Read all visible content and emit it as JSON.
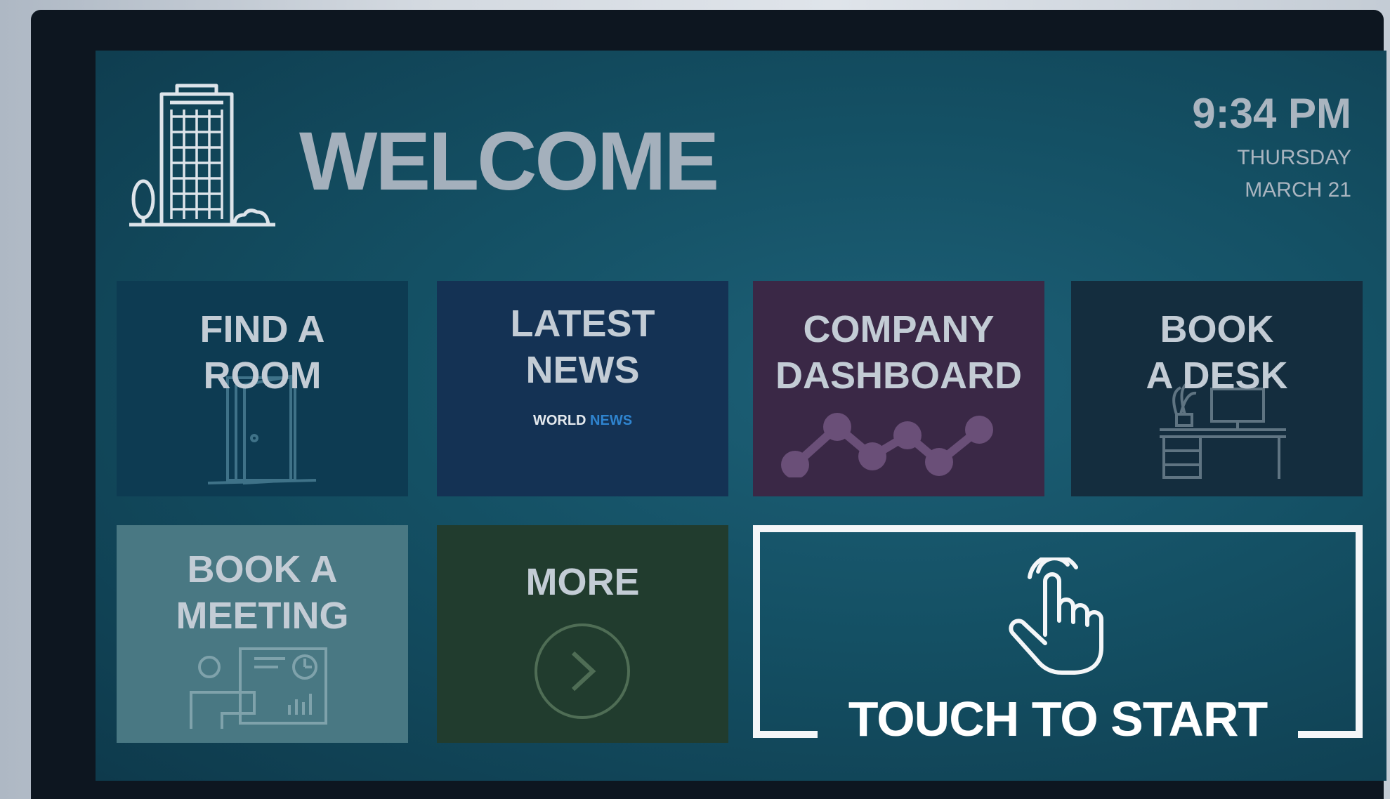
{
  "header": {
    "title": "WELCOME",
    "time": "9:34 PM",
    "day": "THURSDAY",
    "date": "MARCH 21"
  },
  "tiles": [
    {
      "lines": [
        "FIND A",
        "ROOM"
      ],
      "icon": "door-icon",
      "color": "#0d3b52"
    },
    {
      "lines": [
        "LATEST",
        "NEWS"
      ],
      "sub_main": "WORLD",
      "sub_accent": "NEWS",
      "color": "#143254"
    },
    {
      "lines": [
        "COMPANY",
        "DASHBOARD"
      ],
      "icon": "line-chart-icon",
      "color": "#3a2846"
    },
    {
      "lines": [
        "BOOK",
        "A DESK"
      ],
      "icon": "desk-icon",
      "color": "#142d3e"
    },
    {
      "lines": [
        "BOOK A",
        "MEETING"
      ],
      "icon": "meeting-icon",
      "color": "#497883"
    },
    {
      "lines": [
        "MORE"
      ],
      "icon": "chevron-right-icon",
      "color": "#213c2e"
    }
  ],
  "touch": {
    "label": "TOUCH TO START",
    "icon": "hand-pointer-icon"
  },
  "colors": {
    "accent_blue": "#2f84cf",
    "label": "#c3ccd5"
  }
}
